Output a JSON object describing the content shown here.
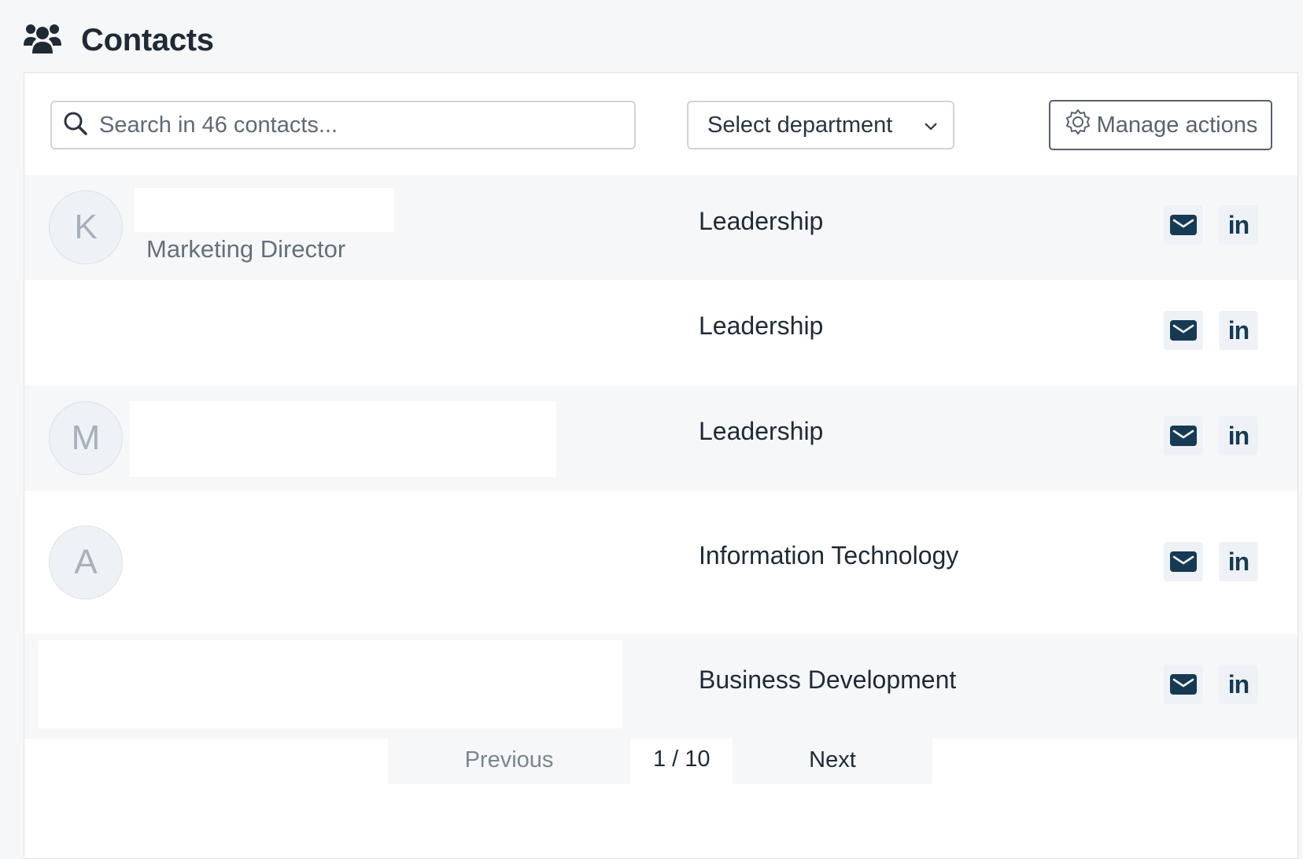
{
  "header": {
    "title": "Contacts",
    "icon": "users-icon"
  },
  "toolbar": {
    "search_placeholder": "Search in 46 contacts...",
    "department_select": "Select department",
    "manage_actions": "Manage actions"
  },
  "rows": [
    {
      "avatar": "K",
      "subtitle": "Marketing Director",
      "department": "Leadership"
    },
    {
      "avatar": "",
      "subtitle": "",
      "department": "Leadership"
    },
    {
      "avatar": "M",
      "subtitle": "",
      "department": "Leadership"
    },
    {
      "avatar": "A",
      "subtitle": "",
      "department": "Information Technology"
    },
    {
      "avatar": "",
      "subtitle": "",
      "department": "Business Development"
    }
  ],
  "actions": {
    "linkedin_label": "in"
  },
  "pagination": {
    "previous": "Previous",
    "page": "1 / 10",
    "next": "Next"
  },
  "colors": {
    "icon_dark": "#163a54",
    "row_alt": "#f6f7f9",
    "border": "#cfd4da"
  }
}
